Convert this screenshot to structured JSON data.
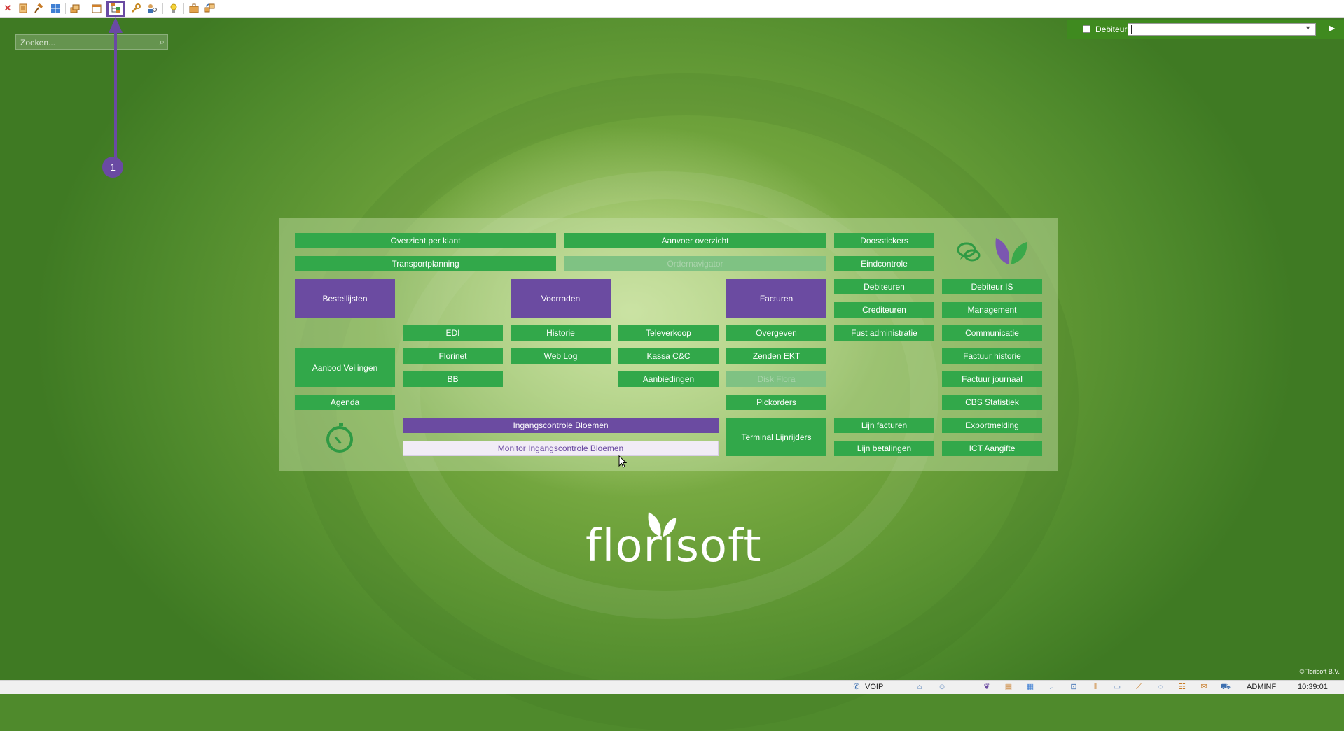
{
  "toolbar": {
    "icons": [
      "close-icon",
      "document-icon",
      "auction-hammer-icon",
      "grid-icon",
      "boxes-icon",
      "calendar-icon",
      "tree-structure-icon",
      "wrench-icon",
      "user-search-icon",
      "lightbulb-icon",
      "briefcase-icon",
      "transfer-icon"
    ]
  },
  "search": {
    "placeholder": "Zoeken..."
  },
  "debiteur": {
    "label": "Debiteur",
    "value": ""
  },
  "callout": {
    "number": "1"
  },
  "menu": {
    "overzicht_per_klant": "Overzicht per klant",
    "aanvoer_overzicht": "Aanvoer overzicht",
    "doosstickers": "Doosstickers",
    "transportplanning": "Transportplanning",
    "ordernavigator": "Ordernavigator",
    "eindcontrole": "Eindcontrole",
    "bestellijsten": "Bestellijsten",
    "voorraden": "Voorraden",
    "facturen": "Facturen",
    "debiteuren": "Debiteuren",
    "debiteur_is": "Debiteur IS",
    "crediteuren": "Crediteuren",
    "management": "Management",
    "edi": "EDI",
    "historie": "Historie",
    "televerkoop": "Televerkoop",
    "overgeven": "Overgeven",
    "fust_administratie": "Fust administratie",
    "communicatie": "Communicatie",
    "aanbod_veilingen": "Aanbod Veilingen",
    "florinet": "Florinet",
    "web_log": "Web Log",
    "kassa": "Kassa C&C",
    "zenden_ekt": "Zenden EKT",
    "factuur_historie": "Factuur historie",
    "bb": "BB",
    "aanbiedingen": "Aanbiedingen",
    "disk_flora": "Disk Flora",
    "factuur_journaal": "Factuur journaal",
    "agenda": "Agenda",
    "pickorders": "Pickorders",
    "cbs_statistiek": "CBS Statistiek",
    "ingangscontrole": "Ingangscontrole Bloemen",
    "terminal_lijnrijders": "Terminal Lijnrijders",
    "lijn_facturen": "Lijn facturen",
    "exportmelding": "Exportmelding",
    "monitor_ingangscontrole": "Monitor Ingangscontrole Bloemen",
    "lijn_betalingen": "Lijn betalingen",
    "ict_aangifte": "ICT Aangifte"
  },
  "logo": {
    "text": "florisoft"
  },
  "copyright": "©Florisoft B.V.",
  "statusbar": {
    "voip": "VOIP",
    "user": "ADMINF",
    "time": "10:39:01"
  },
  "colors": {
    "green_button": "#32a84a",
    "purple_button": "#6b4ba1",
    "debiteur_bar": "#3f8a1f",
    "callout": "#6a4aa3"
  }
}
